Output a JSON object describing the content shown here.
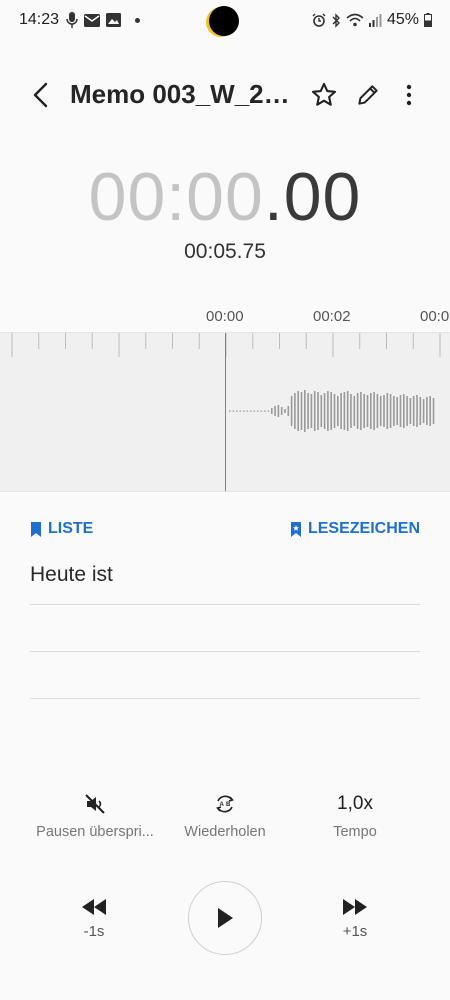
{
  "status_bar": {
    "time": "14:23",
    "battery": "45%"
  },
  "header": {
    "title": "Memo 003_W_20..."
  },
  "timer": {
    "elapsed_main": "00:00",
    "elapsed_fraction": ".00",
    "total": "00:05.75"
  },
  "ruler": {
    "labels": [
      "00:00",
      "00:02",
      "00:0"
    ]
  },
  "links": {
    "list_label": "LISTE",
    "bookmarks_label": "LESEZEICHEN"
  },
  "bookmarks": [
    "Heute ist",
    "",
    ""
  ],
  "options": {
    "skip_silence_label": "Pausen überspri...",
    "repeat_label": "Wiederholen",
    "speed_value": "1,0x",
    "speed_label": "Tempo"
  },
  "controls": {
    "rewind_label": "-1s",
    "forward_label": "+1s"
  },
  "colors": {
    "accent": "#1f6fd1",
    "playhead": "#e05a5a",
    "wave": "#9a9a9a"
  }
}
